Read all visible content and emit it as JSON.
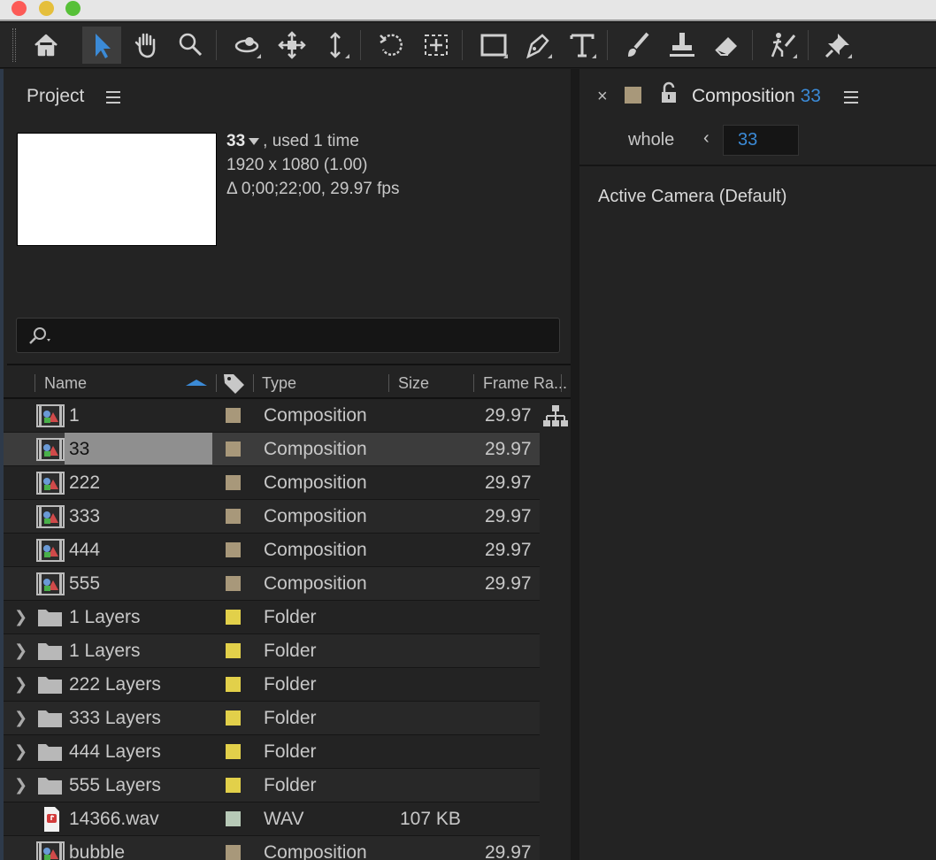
{
  "toolbar": {
    "tools": [
      "home-icon",
      "selection-arrow-icon",
      "hand-icon",
      "zoom-icon",
      "orbit-camera-icon",
      "pan-camera-icon",
      "dolly-camera-icon",
      "rotation-icon",
      "pan-behind-icon",
      "rectangle-icon",
      "pen-icon",
      "text-icon",
      "brush-icon",
      "clone-stamp-icon",
      "eraser-icon",
      "puppet-icon",
      "pin-icon"
    ]
  },
  "project": {
    "title": "Project",
    "selected_comp": {
      "name": "33",
      "usage": ", used 1 time",
      "resolution": "1920 x 1080 (1.00)",
      "duration": "Δ 0;00;22;00, 29.97 fps"
    },
    "search": {
      "placeholder": ""
    },
    "columns": {
      "name": "Name",
      "type": "Type",
      "size": "Size",
      "fps": "Frame Ra..."
    },
    "rows": [
      {
        "name": "1",
        "kind": "comp",
        "label_color": "#a8987a",
        "type": "Composition",
        "size": "",
        "fps": "29.97"
      },
      {
        "name": "33",
        "kind": "comp",
        "label_color": "#a8987a",
        "type": "Composition",
        "size": "",
        "fps": "29.97",
        "selected": true
      },
      {
        "name": "222",
        "kind": "comp",
        "label_color": "#a8987a",
        "type": "Composition",
        "size": "",
        "fps": "29.97"
      },
      {
        "name": "333",
        "kind": "comp",
        "label_color": "#a8987a",
        "type": "Composition",
        "size": "",
        "fps": "29.97"
      },
      {
        "name": "444",
        "kind": "comp",
        "label_color": "#a8987a",
        "type": "Composition",
        "size": "",
        "fps": "29.97"
      },
      {
        "name": "555",
        "kind": "comp",
        "label_color": "#a8987a",
        "type": "Composition",
        "size": "",
        "fps": "29.97"
      },
      {
        "name": "1 Layers",
        "kind": "folder",
        "label_color": "#e2d04a",
        "type": "Folder",
        "size": "",
        "fps": ""
      },
      {
        "name": "1 Layers",
        "kind": "folder",
        "label_color": "#e2d04a",
        "type": "Folder",
        "size": "",
        "fps": ""
      },
      {
        "name": "222 Layers",
        "kind": "folder",
        "label_color": "#e2d04a",
        "type": "Folder",
        "size": "",
        "fps": ""
      },
      {
        "name": "333 Layers",
        "kind": "folder",
        "label_color": "#e2d04a",
        "type": "Folder",
        "size": "",
        "fps": ""
      },
      {
        "name": "444 Layers",
        "kind": "folder",
        "label_color": "#e2d04a",
        "type": "Folder",
        "size": "",
        "fps": ""
      },
      {
        "name": "555 Layers",
        "kind": "folder",
        "label_color": "#e2d04a",
        "type": "Folder",
        "size": "",
        "fps": ""
      },
      {
        "name": "14366.wav",
        "kind": "audio",
        "label_color": "#b7c9b7",
        "type": "WAV",
        "size": "107 KB",
        "fps": ""
      },
      {
        "name": "bubble",
        "kind": "comp",
        "label_color": "#a8987a",
        "type": "Composition",
        "size": "",
        "fps": "29.97"
      }
    ]
  },
  "composition": {
    "close": "×",
    "title": "Composition",
    "title_number": "33",
    "view_label": "whole",
    "back": "‹",
    "current": "33",
    "camera": "Active Camera (Default)"
  }
}
